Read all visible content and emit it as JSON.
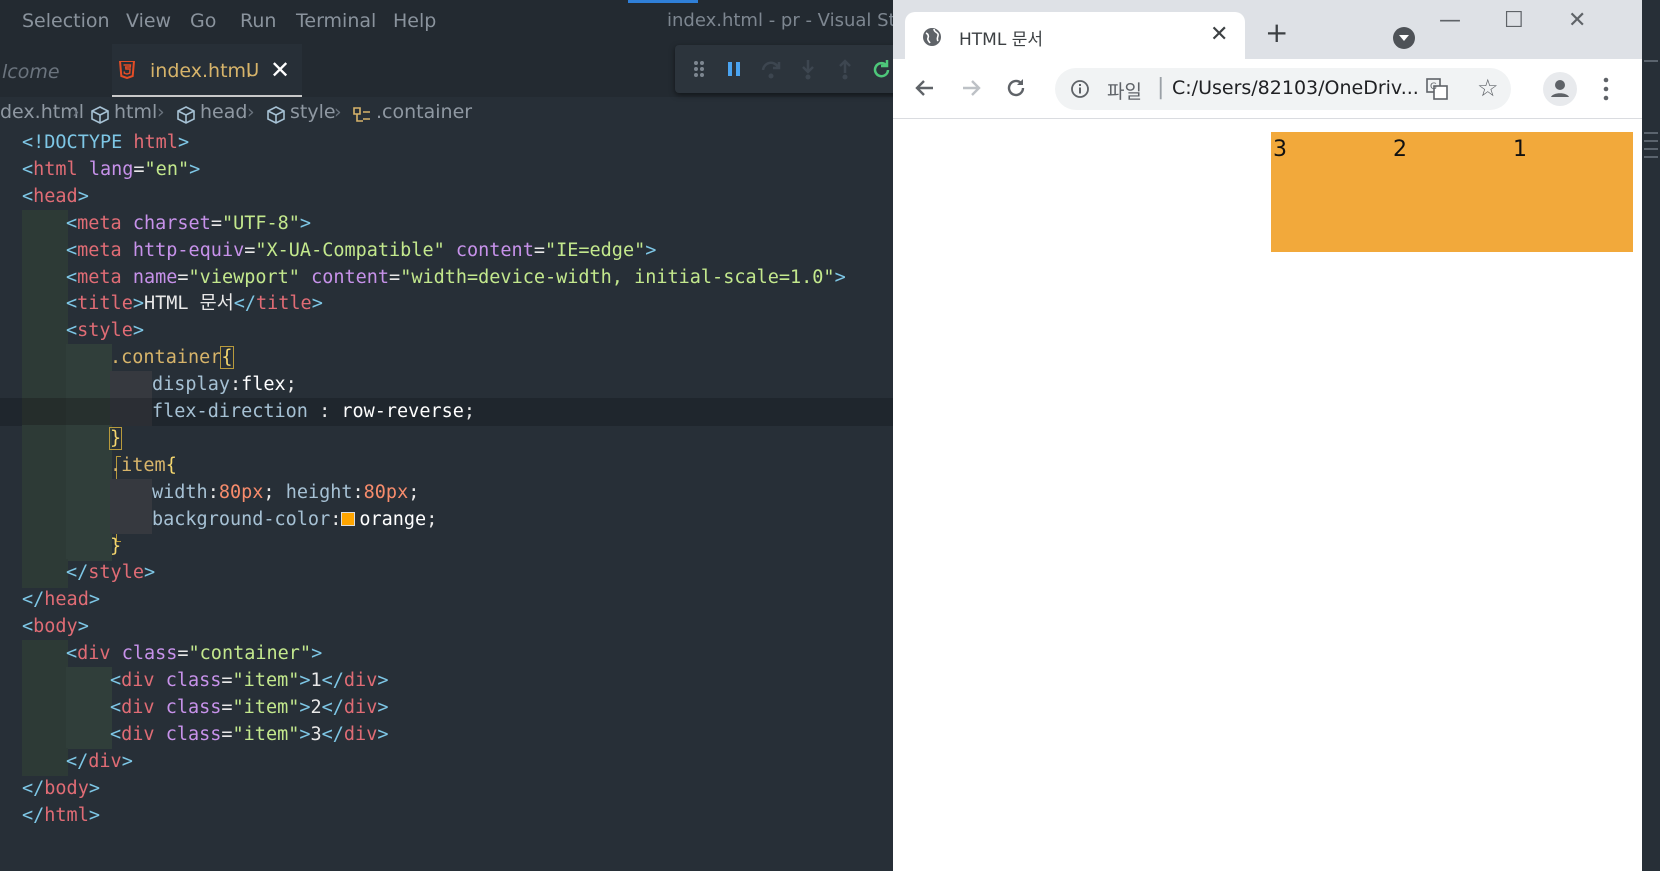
{
  "vscode": {
    "menu": [
      "Selection",
      "View",
      "Go",
      "Run",
      "Terminal",
      "Help"
    ],
    "window_title": "index.html - pr - Visual Studi",
    "tabs": {
      "welcome": "lcome",
      "active": {
        "label": "index.html",
        "status": "U",
        "close": "✕"
      }
    },
    "breadcrumb": [
      "dex.html",
      "html",
      "head",
      "style",
      ".container"
    ],
    "code": {
      "l1": [
        "<!DOCTYPE",
        " html",
        ">"
      ],
      "l2": [
        "<",
        "html",
        " lang",
        "=",
        "\"en\"",
        ">"
      ],
      "l3": [
        "<",
        "head",
        ">"
      ],
      "l4": [
        "<",
        "meta",
        " charset",
        "=",
        "\"UTF-8\"",
        ">"
      ],
      "l5": [
        "<",
        "meta",
        " http-equiv",
        "=",
        "\"X-UA-Compatible\"",
        " content",
        "=",
        "\"IE=edge\"",
        ">"
      ],
      "l6": [
        "<",
        "meta",
        " name",
        "=",
        "\"viewport\"",
        " content",
        "=",
        "\"width=device-width, initial-scale=1.0\"",
        ">"
      ],
      "l7": [
        "<",
        "title",
        ">",
        "HTML 문서",
        "</",
        "title",
        ">"
      ],
      "l8": [
        "<",
        "style",
        ">"
      ],
      "l9": [
        ".container",
        "{"
      ],
      "l10": [
        "display",
        ":",
        "flex",
        ";"
      ],
      "l11": [
        "flex-direction",
        " : ",
        "row-reverse",
        ";"
      ],
      "l12": [
        "}"
      ],
      "l13": [
        ".item",
        "{"
      ],
      "l14": [
        "width",
        ":",
        "80px",
        "; ",
        "height",
        ":",
        "80px",
        ";"
      ],
      "l15": [
        "background-color",
        ":",
        "orange",
        ";"
      ],
      "l16": [
        "}"
      ],
      "l17": [
        "</",
        "style",
        ">"
      ],
      "l18": [
        "</",
        "head",
        ">"
      ],
      "l19": [
        "<",
        "body",
        ">"
      ],
      "l20": [
        "<",
        "div",
        " class",
        "=",
        "\"container\"",
        ">"
      ],
      "l21": [
        "<",
        "div",
        " class",
        "=",
        "\"item\"",
        ">",
        "1",
        "</",
        "div",
        ">"
      ],
      "l22": [
        "<",
        "div",
        " class",
        "=",
        "\"item\"",
        ">",
        "2",
        "</",
        "div",
        ">"
      ],
      "l23": [
        "<",
        "div",
        " class",
        "=",
        "\"item\"",
        ">",
        "3",
        "</",
        "div",
        ">"
      ],
      "l24": [
        "</",
        "div",
        ">"
      ],
      "l25": [
        "</",
        "body",
        ">"
      ],
      "l26": [
        "</",
        "html",
        ">"
      ]
    },
    "swatch_color": "#ffa500"
  },
  "chrome": {
    "tab_title": "HTML 문서",
    "tab_close": "✕",
    "new_tab": "+",
    "window_controls": [
      "—",
      "☐",
      "✕"
    ],
    "omnibox": {
      "scheme": "파일",
      "separator": "|",
      "url": "C:/Users/82103/OneDriv..."
    },
    "page": {
      "container_color": "#f2a93b",
      "items": [
        "1",
        "2",
        "3"
      ]
    }
  }
}
